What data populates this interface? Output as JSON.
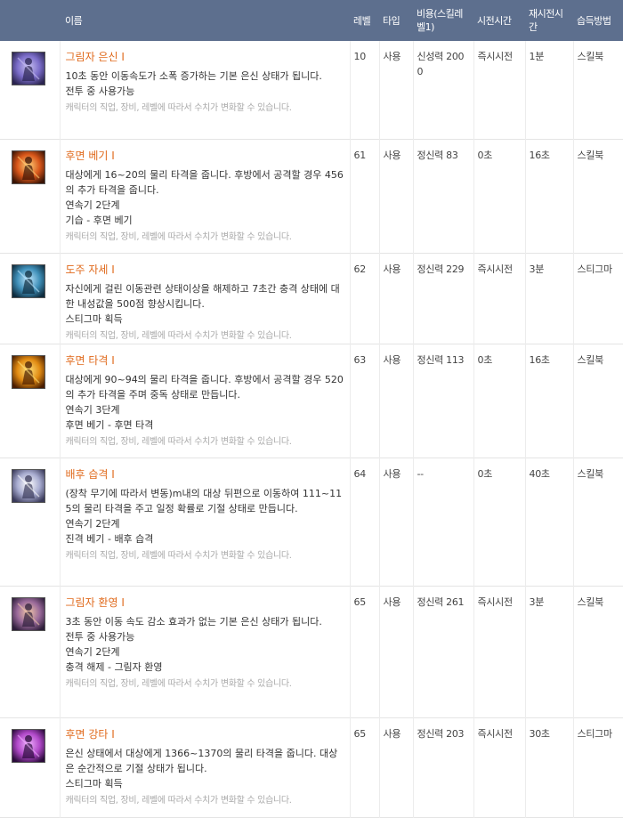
{
  "headers": {
    "name": "이름",
    "level": "레벨",
    "type": "타입",
    "cost": "비용(스킬레벨1)",
    "cast": "시전시간",
    "cooldown": "재시전시간",
    "learn": "습득방법"
  },
  "note_text": "캐릭터의 직업, 장비, 레벨에 따라서 수치가 변화할 수 있습니다.",
  "skills": [
    {
      "icon": "stealth-figure-icon",
      "name": "그림자 은신 I",
      "desc": [
        "10초 동안 이동속도가 소폭 증가하는 기본 은신 상태가 됩니다.",
        "전투 중 사용가능"
      ],
      "level": "10",
      "type": "사용",
      "cost": "신성력 2000",
      "cast": "즉시시전",
      "cooldown": "1분",
      "learn": "스킬북",
      "icon_colors": [
        "#2a2450",
        "#7a6cc8",
        "#c9c2f2"
      ]
    },
    {
      "icon": "back-slash-icon",
      "name": "후면 베기 I",
      "desc": [
        "대상에게 16~20의 물리 타격을 줍니다. 후방에서 공격할 경우 456의 추가 타격을 줍니다.",
        "연속기 2단계",
        "기습 - 후면 베기"
      ],
      "level": "61",
      "type": "사용",
      "cost": "정신력 83",
      "cast": "0초",
      "cooldown": "16초",
      "learn": "스킬북",
      "icon_colors": [
        "#3a1405",
        "#d8561a",
        "#ffd27a"
      ]
    },
    {
      "icon": "thief-stance-icon",
      "name": "도주 자세 I",
      "desc": [
        "자신에게 걸린 이동관련 상태이상을 해제하고 7초간 충격 상태에 대한 내성값을 500점 향상시킵니다.",
        "스티그마 획득"
      ],
      "level": "62",
      "type": "사용",
      "cost": "정신력 229",
      "cast": "즉시시전",
      "cooldown": "3분",
      "learn": "스티그마",
      "icon_colors": [
        "#0e2c3e",
        "#3f8fb8",
        "#bfe8ff"
      ]
    },
    {
      "icon": "back-strike-icon",
      "name": "후면 타격 I",
      "desc": [
        "대상에게 90~94의 물리 타격을 줍니다. 후방에서 공격할 경우 520의 추가 타격을 주며 중독 상태로 만듭니다.",
        "연속기 3단계",
        "후면 베기 - 후면 타격"
      ],
      "level": "63",
      "type": "사용",
      "cost": "정신력 113",
      "cast": "0초",
      "cooldown": "16초",
      "learn": "스킬북",
      "icon_colors": [
        "#4a1e02",
        "#e08a12",
        "#ffe27a"
      ]
    },
    {
      "icon": "ambush-blade-icon",
      "name": "배후 습격 I",
      "desc": [
        "(장착 무기에 따라서 변동)m내의 대상 뒤편으로 이동하여 111~115의 물리 타격을 주고 일정 확률로 기절 상태로 만듭니다.",
        "연속기 2단계",
        "진격 베기 - 배후 습격"
      ],
      "level": "64",
      "type": "사용",
      "cost": "--",
      "cast": "0초",
      "cooldown": "40초",
      "learn": "스킬북",
      "icon_colors": [
        "#3a3a5a",
        "#a8acd0",
        "#ffffff"
      ]
    },
    {
      "icon": "shadow-illusion-icon",
      "name": "그림자 환영 I",
      "desc": [
        "3초 동안 이동 속도 감소 효과가 없는 기본 은신 상태가 됩니다.",
        "전투 중 사용가능",
        "연속기 2단계",
        "충격 해제 - 그림자 환영"
      ],
      "level": "65",
      "type": "사용",
      "cost": "정신력 261",
      "cast": "즉시시전",
      "cooldown": "3분",
      "learn": "스킬북",
      "icon_colors": [
        "#2e1e3a",
        "#9a6a9a",
        "#f2c8a8"
      ]
    },
    {
      "icon": "rear-heavy-strike-icon",
      "name": "후면 강타 I",
      "desc": [
        "은신 상태에서 대상에게 1366~1370의 물리 타격을 줍니다. 대상은 순간적으로 기절 상태가 됩니다.",
        "스티그마 획득"
      ],
      "level": "65",
      "type": "사용",
      "cost": "정신력 203",
      "cast": "즉시시전",
      "cooldown": "30초",
      "learn": "스티그마",
      "icon_colors": [
        "#2a0a3a",
        "#b048c8",
        "#f0b0ff"
      ]
    }
  ]
}
